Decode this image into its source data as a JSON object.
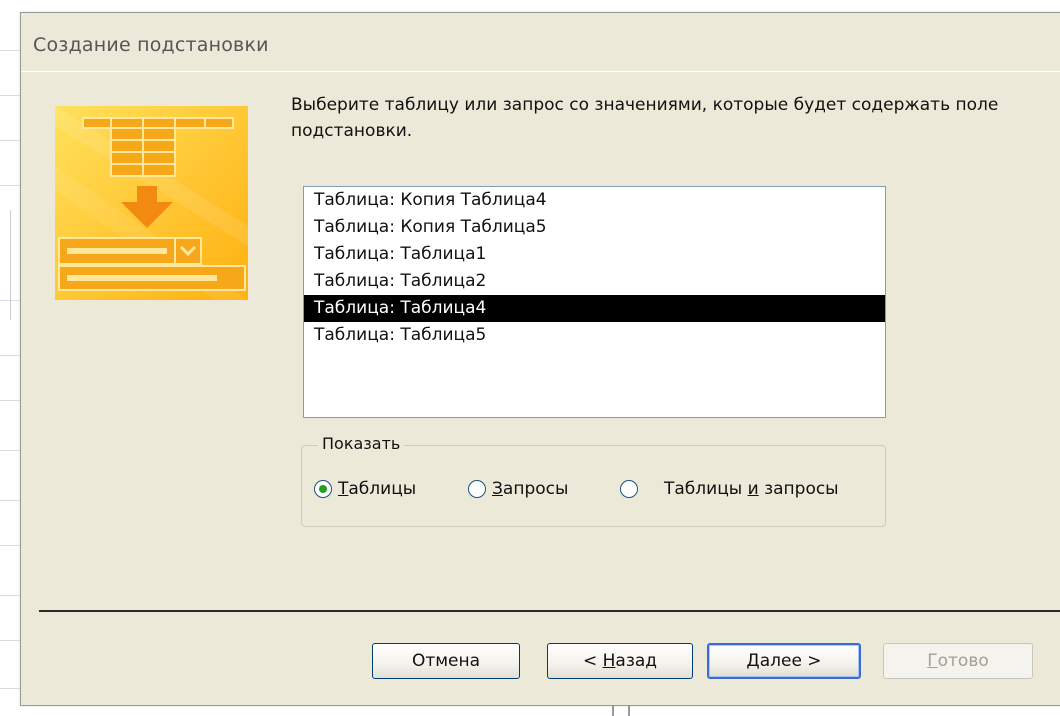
{
  "dialog": {
    "title": "Создание подстановки",
    "instruction": "Выберите таблицу или запрос со значениями, которые будет содержать поле подстановки."
  },
  "list": {
    "items": [
      "Таблица: Копия Таблица4",
      "Таблица: Копия Таблица5",
      "Таблица: Таблица1",
      "Таблица: Таблица2",
      "Таблица: Таблица4",
      "Таблица: Таблица5"
    ],
    "selected": "Таблица: Таблица4"
  },
  "show": {
    "legend": "Показать",
    "options": [
      {
        "pre": "",
        "acc": "Т",
        "post": "аблицы",
        "checked": true
      },
      {
        "pre": "",
        "acc": "З",
        "post": "апросы",
        "checked": false
      },
      {
        "pre": "Таблицы ",
        "acc": "и",
        "post": " запросы",
        "checked": false
      }
    ]
  },
  "buttons": {
    "cancel": {
      "pre": "Отмена",
      "acc": "",
      "post": ""
    },
    "back": {
      "pre": "< ",
      "acc": "Н",
      "post": "азад"
    },
    "next": {
      "pre": "",
      "acc": "Д",
      "post": "алее >"
    },
    "finish": {
      "pre": "",
      "acc": "Г",
      "post": "отово"
    }
  },
  "colors": {
    "dialog_bg": "#ece9d8",
    "selection_bg": "#000000",
    "radio_dot": "#21a121",
    "wizard_yellow": "#ffc11f"
  },
  "icons": {
    "wizard_picture": "lookup-wizard-icon"
  }
}
